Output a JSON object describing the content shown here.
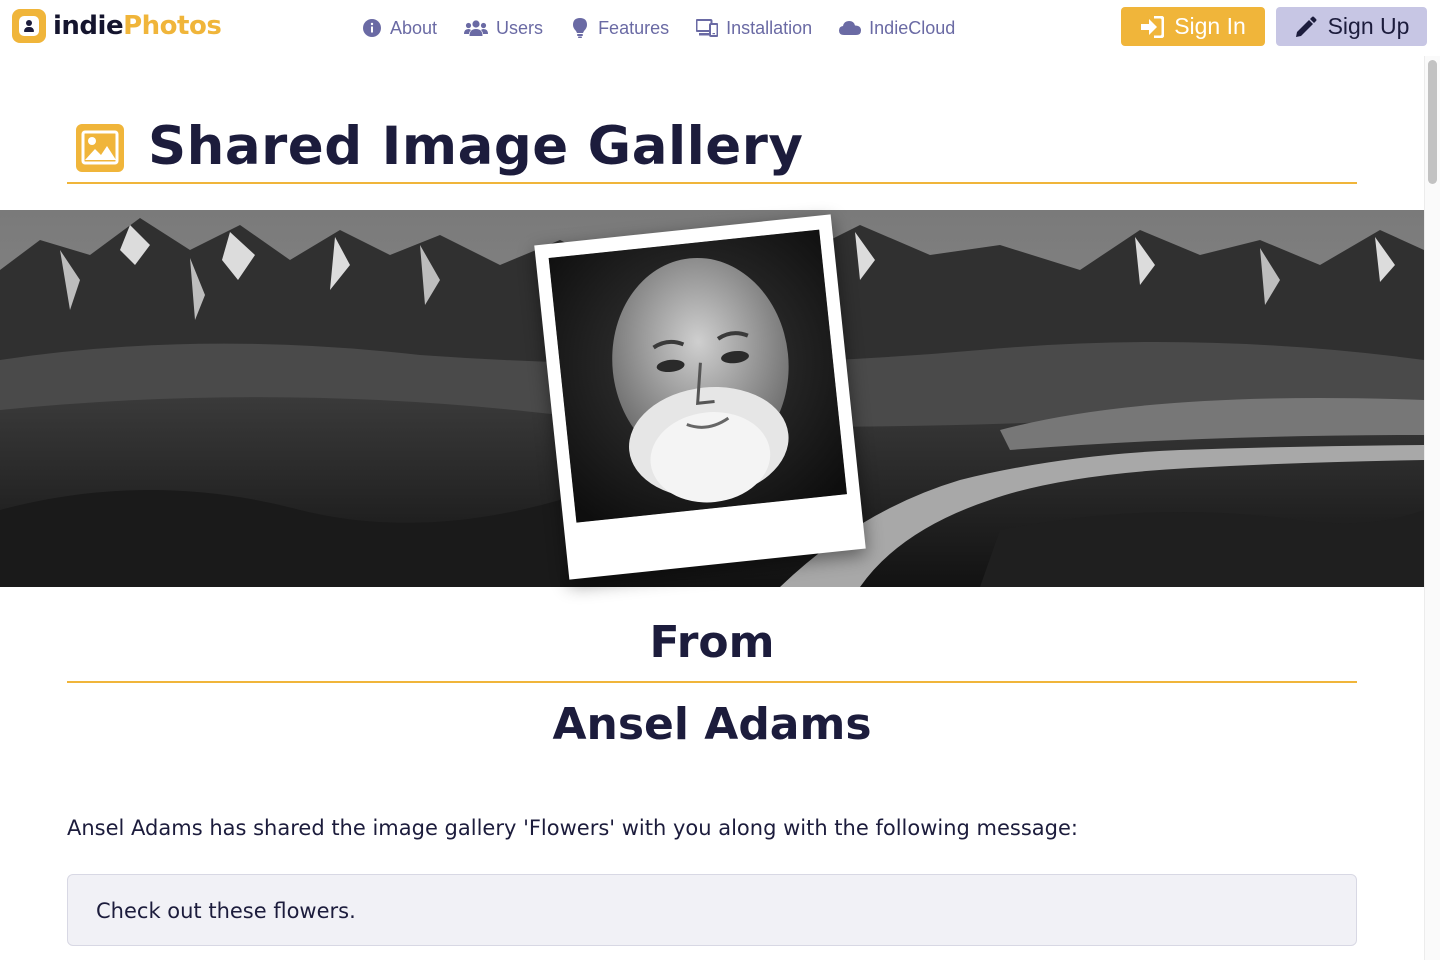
{
  "brand": {
    "name_part1": "indie",
    "name_part2": "Photos",
    "icon": "user-portrait-icon"
  },
  "nav": {
    "items": [
      {
        "label": "About",
        "icon": "info-circle-icon"
      },
      {
        "label": "Users",
        "icon": "users-icon"
      },
      {
        "label": "Features",
        "icon": "lightbulb-icon"
      },
      {
        "label": "Installation",
        "icon": "devices-icon"
      },
      {
        "label": "IndieCloud",
        "icon": "cloud-icon"
      }
    ],
    "sign_in_label": "Sign In",
    "sign_in_icon": "sign-in-icon",
    "sign_up_label": "Sign Up",
    "sign_up_icon": "pencil-icon"
  },
  "page": {
    "title": "Shared Image Gallery",
    "title_icon": "image-icon",
    "from_label": "From",
    "owner_name": "Ansel Adams",
    "share_text": "Ansel Adams has shared the image gallery 'Flowers' with you along with the following message:",
    "message": "Check out these flowers."
  },
  "colors": {
    "accent": "#f0b53a",
    "nav_text": "#6a6aa4",
    "sign_up_bg": "#c7c6e4",
    "text": "#1c1c3c",
    "message_bg": "#f1f1f6"
  }
}
